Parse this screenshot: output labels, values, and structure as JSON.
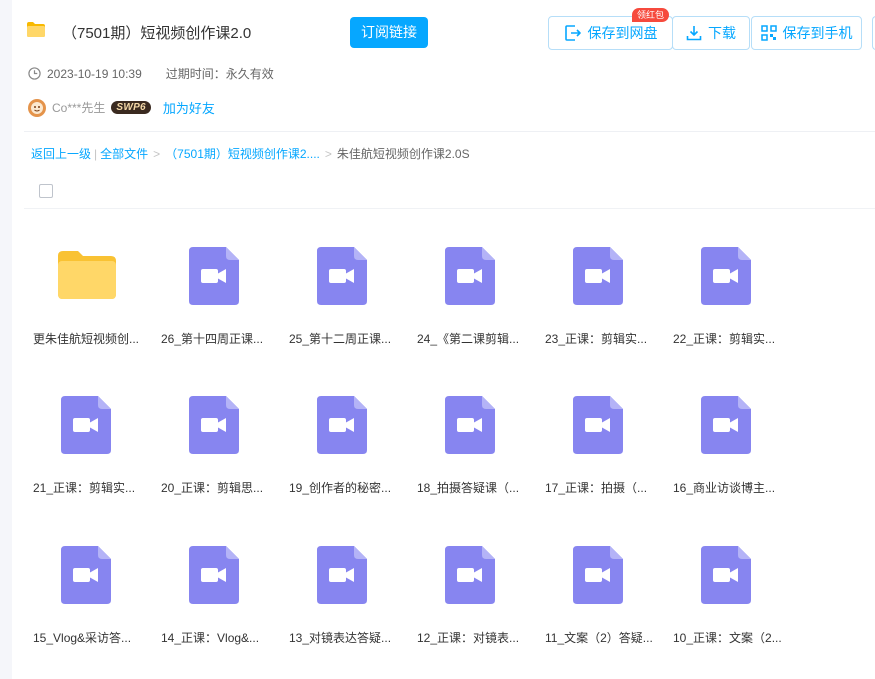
{
  "header": {
    "title": "（7501期）短视频创作课2.0",
    "subscribe_label": "订阅链接",
    "save_label": "保存到网盘",
    "save_badge": "领红包",
    "download_label": "下载",
    "save_phone_label": "保存到手机"
  },
  "meta": {
    "date": "2023-10-19 10:39",
    "expire": "过期时间：永久有效"
  },
  "user": {
    "name": "Co***先生",
    "vip": "SWP6",
    "add_friend": "加为好友"
  },
  "breadcrumb": {
    "back": "返回上一级",
    "all": "全部文件",
    "parent": "（7501期）短视频创作课2....",
    "current": "朱佳航短视频创作课2.0S"
  },
  "files": [
    {
      "name": "更朱佳航短视频创...",
      "type": "folder"
    },
    {
      "name": "26_第十四周正课...",
      "type": "video"
    },
    {
      "name": "25_第十二周正课...",
      "type": "video"
    },
    {
      "name": "24_《第二课剪辑...",
      "type": "video"
    },
    {
      "name": "23_正课：剪辑实...",
      "type": "video"
    },
    {
      "name": "22_正课：剪辑实...",
      "type": "video"
    },
    {
      "name": "21_正课：剪辑实...",
      "type": "video"
    },
    {
      "name": "20_正课：剪辑思...",
      "type": "video"
    },
    {
      "name": "19_创作者的秘密...",
      "type": "video"
    },
    {
      "name": "18_拍摄答疑课（...",
      "type": "video"
    },
    {
      "name": "17_正课：拍摄（...",
      "type": "video"
    },
    {
      "name": "16_商业访谈博主...",
      "type": "video"
    },
    {
      "name": "15_Vlog&采访答...",
      "type": "video"
    },
    {
      "name": "14_正课：Vlog&...",
      "type": "video"
    },
    {
      "name": "13_对镜表达答疑...",
      "type": "video"
    },
    {
      "name": "12_正课：对镜表...",
      "type": "video"
    },
    {
      "name": "11_文案（2）答疑...",
      "type": "video"
    },
    {
      "name": "10_正课：文案（2...",
      "type": "video"
    }
  ],
  "colors": {
    "accent": "#06a7ff",
    "video_icon": "#8785f0",
    "folder_icon": "#ffd768"
  }
}
